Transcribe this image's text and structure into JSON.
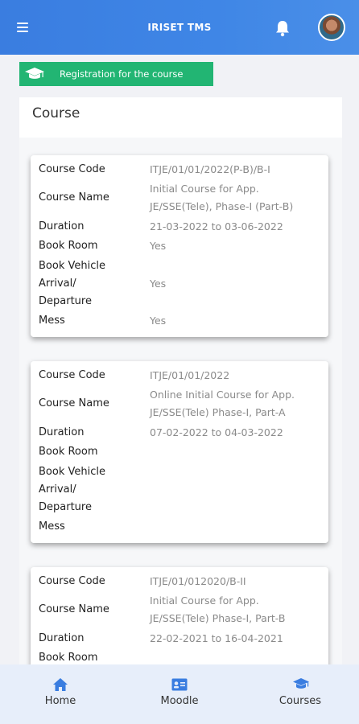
{
  "app": {
    "title": "IRISET TMS"
  },
  "topbar": {
    "menu_icon": "hamburger-menu-icon",
    "bell_icon": "bell-icon",
    "avatar": "user-avatar"
  },
  "registration": {
    "label": "Registration for the course",
    "icon": "graduation-cap-icon",
    "color": "#22b573"
  },
  "section": {
    "title": "Course"
  },
  "labels": {
    "course_code": "Course Code",
    "course_name": "Course Name",
    "duration": "Duration",
    "book_room": "Book Room",
    "book_vehicle": "Book Vehicle",
    "arrival": "Arrival/",
    "departure": "Departure",
    "mess": "Mess"
  },
  "courses": [
    {
      "code": "ITJE/01/01/2022(P-B)/B-I",
      "name_line1": "Initial Course for App.",
      "name_line2": "JE/SSE(Tele), Phase-I (Part-B)",
      "duration": "21-03-2022 to 03-06-2022",
      "book_room": "Yes",
      "book_vehicle": "Yes",
      "mess": "Yes"
    },
    {
      "code": "ITJE/01/01/2022",
      "name_line1": "Online Initial Course for App.",
      "name_line2": "JE/SSE(Tele) Phase-I, Part-A",
      "duration": "07-02-2022 to 04-03-2022",
      "book_room": "",
      "book_vehicle": "",
      "mess": ""
    },
    {
      "code": "ITJE/01/012020/B-II",
      "name_line1": "Initial Course for App.",
      "name_line2": "JE/SSE(Tele) Phase-I, Part-B",
      "duration": "22-02-2021 to 16-04-2021",
      "book_room": "",
      "book_vehicle": "",
      "mess": ""
    }
  ],
  "bottom_nav": {
    "items": [
      {
        "label": "Home",
        "icon": "home-icon"
      },
      {
        "label": "Moodle",
        "icon": "id-card-icon"
      },
      {
        "label": "Courses",
        "icon": "graduation-cap-icon"
      }
    ],
    "icon_color": "#3a7de0"
  }
}
